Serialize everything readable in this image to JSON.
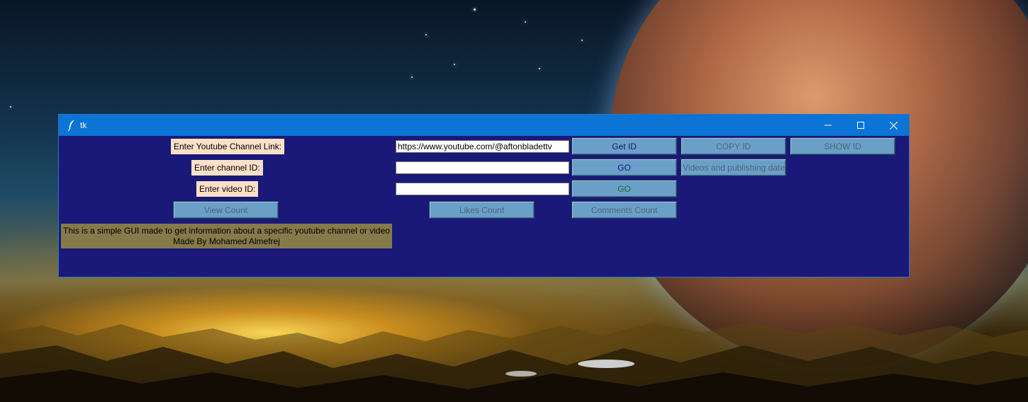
{
  "window": {
    "title": "tk",
    "controls": {
      "minimize": "minimize-icon",
      "maximize": "maximize-icon",
      "close": "close-icon"
    }
  },
  "labels": {
    "channel_link": "Enter Youtube Channel Link:",
    "channel_id": "Enter channel ID:",
    "video_id": "Enter video ID:"
  },
  "inputs": {
    "channel_link_value": "https://www.youtube.com/@aftonbladettv",
    "channel_id_value": "",
    "video_id_value": ""
  },
  "buttons": {
    "get_id": "Get ID",
    "copy_id": "COPY ID",
    "show_id": "SHOW ID",
    "go_channel": "GO",
    "videos_dates": "Videos and publishing dates",
    "go_video": "GO",
    "view_count": "View Count",
    "likes_count": "Likes Count",
    "comments_count": "Comments Count"
  },
  "info": {
    "line1": "This is a simple GUI made to get information about a specific youtube channel or video",
    "line2": "Made By Mohamed Almefrej"
  },
  "colors": {
    "window_bg": "#1a1878",
    "titlebar": "#0b74d4",
    "label_bg": "#fde0c8",
    "button_bg": "#6aa0c8",
    "info_bg": "#857a4a",
    "get_id_text": "#1a1878",
    "go_channel_text": "#1a1878",
    "go_video_text": "#1a6a1a"
  }
}
